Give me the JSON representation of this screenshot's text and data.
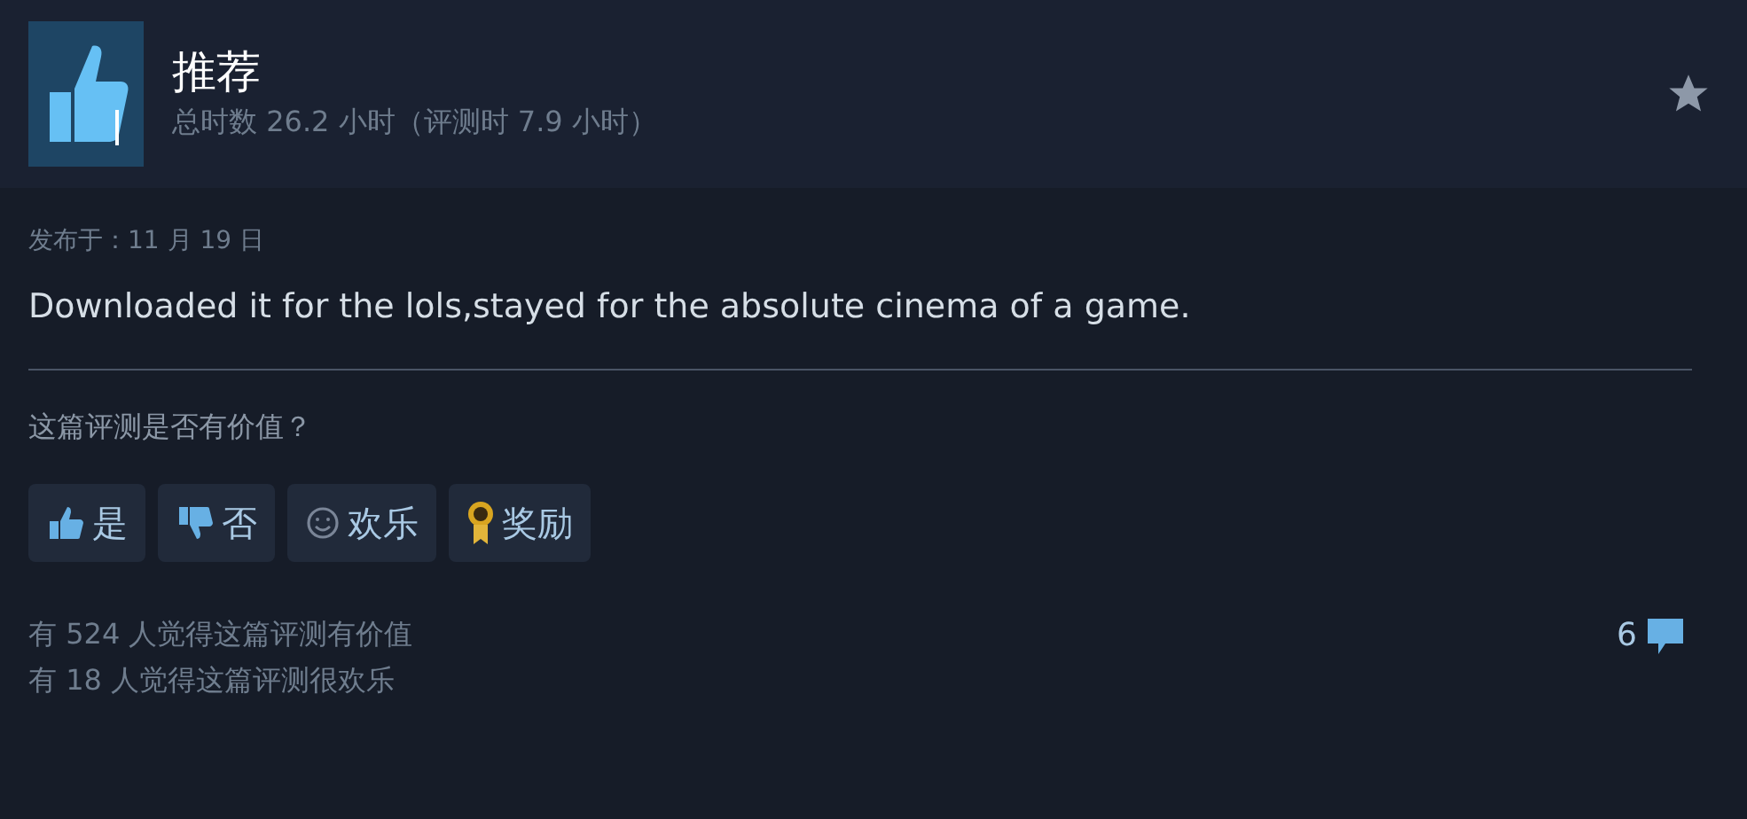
{
  "header": {
    "title": "推荐",
    "playtime": "总时数 26.2 小时（评测时 7.9 小时）"
  },
  "posted": "发布于：11 月 19 日",
  "body": "Downloaded it for the lols,stayed for the absolute cinema of a game.",
  "question": "这篇评测是否有价值？",
  "vote_buttons": [
    {
      "kind": "yes",
      "label": "是"
    },
    {
      "kind": "no",
      "label": "否"
    },
    {
      "kind": "funny",
      "label": "欢乐"
    },
    {
      "kind": "award",
      "label": "奖励"
    }
  ],
  "stats": [
    "有 524 人觉得这篇评测有价值",
    "有 18 人觉得这篇评测很欢乐"
  ],
  "comment_count": "6"
}
